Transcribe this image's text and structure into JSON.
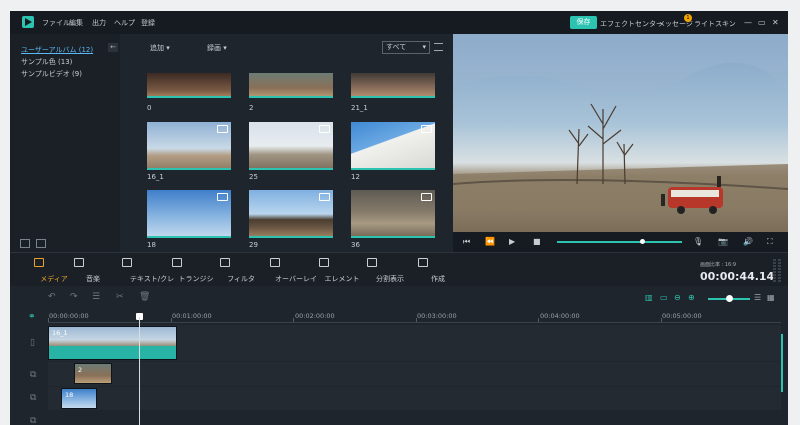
{
  "menu": {
    "items": [
      "ファイル",
      "編集",
      "出力",
      "ヘルプ",
      "登録"
    ]
  },
  "titlebar": {
    "save": "保存",
    "effects": "エフェクトセンター",
    "messages": "メッセージ",
    "badge_count": "1",
    "theme": "ライトスキン"
  },
  "library": {
    "items": [
      {
        "label": "ユーザーアルバム (12)",
        "active": true
      },
      {
        "label": "サンプル色 (13)",
        "active": false
      },
      {
        "label": "サンプルビデオ (9)",
        "active": false
      }
    ]
  },
  "media": {
    "import_label": "追加",
    "record_label": "録画",
    "filter_value": "すべて",
    "thumbnails": [
      {
        "label": "0",
        "video": false
      },
      {
        "label": "2",
        "video": false
      },
      {
        "label": "21_1",
        "video": false
      },
      {
        "label": "16_1",
        "video": true
      },
      {
        "label": "25",
        "video": true
      },
      {
        "label": "12",
        "video": true
      },
      {
        "label": "18",
        "video": true
      },
      {
        "label": "29",
        "video": true
      },
      {
        "label": "36",
        "video": true
      }
    ]
  },
  "player": {
    "progress": 0.68
  },
  "toolbar": {
    "tools": [
      {
        "name": "media",
        "label": "メディア",
        "active": true
      },
      {
        "name": "audio",
        "label": "音楽",
        "active": false
      },
      {
        "name": "text",
        "label": "テキスト/クレジット",
        "active": false
      },
      {
        "name": "transition",
        "label": "トランジション",
        "active": false
      },
      {
        "name": "filter",
        "label": "フィルター",
        "active": false
      },
      {
        "name": "overlay",
        "label": "オーバーレイ",
        "active": false
      },
      {
        "name": "element",
        "label": "エレメント",
        "active": false
      },
      {
        "name": "split",
        "label": "分割表示",
        "active": false
      },
      {
        "name": "export",
        "label": "作成",
        "active": false
      }
    ],
    "ratio_label": "画面比率 : 16:9",
    "timecode": "00:00:44.14"
  },
  "timeline": {
    "ruler": [
      "00:00:00:00",
      "00:01:00:00",
      "00:02:00:00",
      "00:03:00:00",
      "00:04:00:00",
      "00:05:00:00"
    ],
    "clips": [
      {
        "label": "16_1"
      },
      {
        "label": "2"
      },
      {
        "label": "18"
      }
    ],
    "zoom": 0.43
  },
  "colors": {
    "accent": "#2dc3b1",
    "active_tool": "#e7a329",
    "link": "#5ab8f2"
  }
}
